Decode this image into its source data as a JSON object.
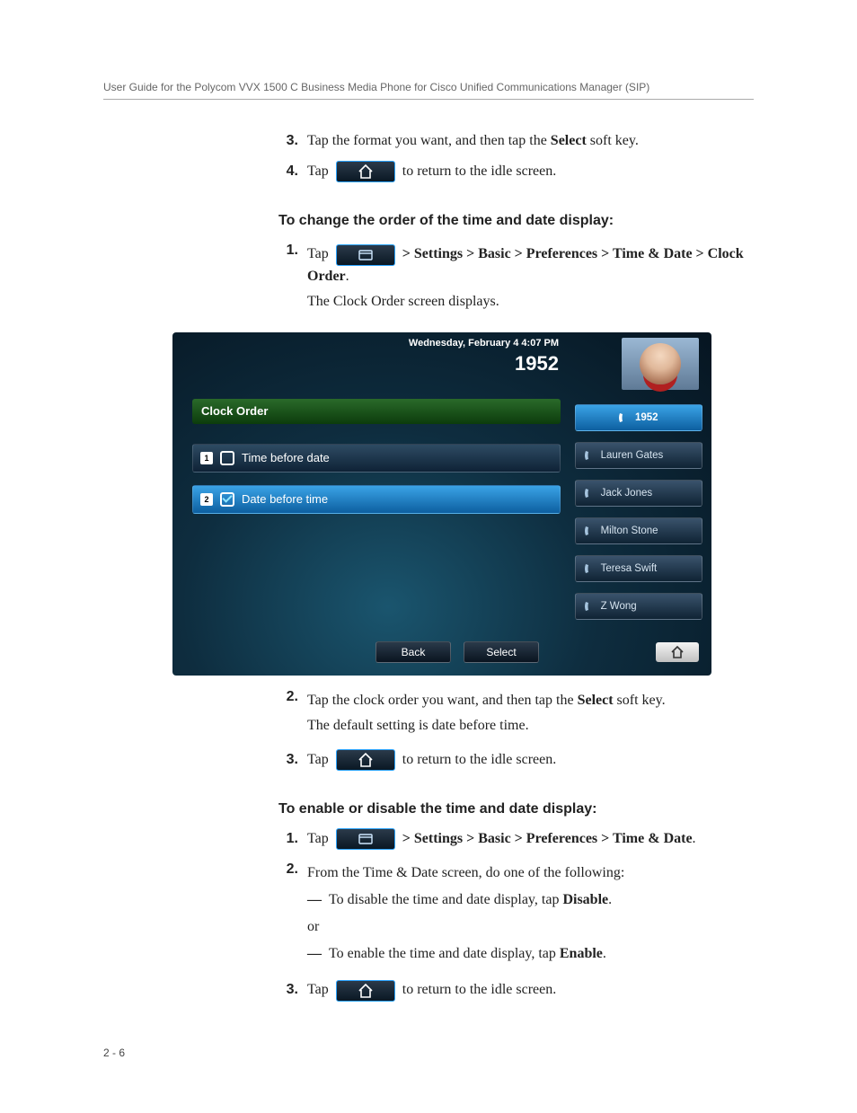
{
  "header": "User Guide for the Polycom VVX 1500 C Business Media Phone for Cisco Unified Communications Manager (SIP)",
  "pageref": "2 - 6",
  "step3a_pre": "Tap the format you want, and then tap the ",
  "step3a_bold": "Select",
  "step3a_post": " soft key.",
  "tap_word": "Tap ",
  "return_idle": " to return to the idle screen.",
  "heading_order": "To change the order of the time and date display:",
  "path_order_pre": "  > Settings > Basic > Preferences > Time & Date > ",
  "path_order_bold": "Clock Order",
  "period": ".",
  "clock_order_display": "The Clock Order screen displays.",
  "shot": {
    "date": "Wednesday, February 4  4:07 PM",
    "extension": "1952",
    "title": "Clock Order",
    "opt1": "Time before date",
    "opt2": "Date before time",
    "contacts": [
      "1952",
      "Lauren Gates",
      "Jack Jones",
      "Milton Stone",
      "Teresa Swift",
      "Z Wong"
    ],
    "back": "Back",
    "select": "Select"
  },
  "step2b_pre": "Tap the clock order you want, and then tap the ",
  "step2b_bold": "Select",
  "step2b_post": " soft key.",
  "default_note": "The default setting is date before time.",
  "heading_enable": "To enable or disable the time and date display:",
  "path_enable": "  > Settings > Basic > Preferences > Time & Date",
  "step2c": "From the Time & Date screen, do one of the following:",
  "disable_pre": "To disable the time and date display, tap ",
  "disable_bold": "Disable",
  "or": "or",
  "enable_pre": "To enable the time and date display, tap ",
  "enable_bold": "Enable",
  "nums": {
    "n1": "1.",
    "n2": "2.",
    "n3": "3.",
    "n4": "4."
  },
  "dash": "—",
  "icons": {
    "home": "home-icon",
    "menu": "menu-icon"
  }
}
